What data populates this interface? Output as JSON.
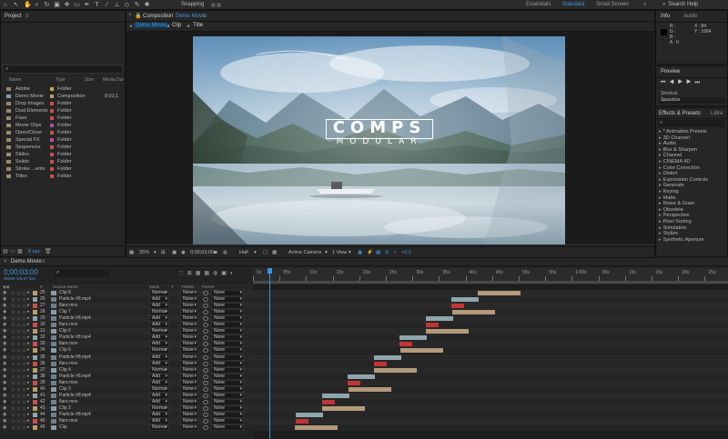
{
  "toolbar": {
    "snapping": "Snapping",
    "workspaces": [
      "Essentials",
      "Standard",
      "Small Screen"
    ],
    "active_workspace": "Standard",
    "search": "Search Help"
  },
  "project": {
    "tab": "Project",
    "columns": [
      "Name",
      "Type",
      "Size",
      "Media Dur"
    ],
    "items": [
      {
        "name": "Adobe",
        "type": "Folder",
        "size": "",
        "color": "#d4a24a"
      },
      {
        "name": "Demo Movie",
        "type": "Composition",
        "size": "0;01;1",
        "color": "#b9a06a"
      },
      {
        "name": "Drop Images",
        "type": "Folder",
        "size": "",
        "color": "#c85050"
      },
      {
        "name": "Dust Elements",
        "type": "Folder",
        "size": "",
        "color": "#c85050"
      },
      {
        "name": "Flare",
        "type": "Folder",
        "size": "",
        "color": "#c85050"
      },
      {
        "name": "Movie Clips",
        "type": "Folder",
        "size": "",
        "color": "#b04fa8"
      },
      {
        "name": "Open/Close",
        "type": "Folder",
        "size": "",
        "color": "#c85050"
      },
      {
        "name": "Special FX",
        "type": "Folder",
        "size": "",
        "color": "#b04fa8"
      },
      {
        "name": "Sequences",
        "type": "Folder",
        "size": "",
        "color": "#c85050"
      },
      {
        "name": "Slides",
        "type": "Folder",
        "size": "",
        "color": "#c85050"
      },
      {
        "name": "Solids",
        "type": "Folder",
        "size": "",
        "color": "#c85050"
      },
      {
        "name": "Stroke ...ents",
        "type": "Folder",
        "size": "",
        "color": "#c85050"
      },
      {
        "name": "Titles",
        "type": "Folder",
        "size": "",
        "color": "#c85050"
      }
    ],
    "bpc": "8 bpc"
  },
  "composition": {
    "tab_prefix": "Composition",
    "tab_name": "Demo Movie",
    "breadcrumbs": [
      "Demo Movie",
      "Clip",
      "Title"
    ],
    "title_main": "COMPS",
    "title_sub": "MODULAR",
    "zoom": "25%",
    "timecode": "0;00;03;00",
    "resolution": "Half",
    "camera": "Active Camera",
    "view": "1 View",
    "exposure": "+0.0"
  },
  "info": {
    "tabs": [
      "Info",
      "Audio"
    ],
    "channels": [
      "R :",
      "G :",
      "B :",
      "A : 0"
    ],
    "x": "X : 84",
    "y": "Y : 1664"
  },
  "preview": {
    "tab": "Preview",
    "shortcut_label": "Shortcut",
    "shortcut_value": "Spacebar"
  },
  "effects": {
    "tabs": [
      "Effects & Presets",
      "Libra"
    ],
    "items": [
      "* Animation Presets",
      "3D Channel",
      "Audio",
      "Blur & Sharpen",
      "Channel",
      "CINEMA 4D",
      "Color Correction",
      "Distort",
      "Expression Controls",
      "Generate",
      "Keying",
      "Matte",
      "Noise & Grain",
      "Obsolete",
      "Perspective",
      "Pixel Sorting",
      "Simulation",
      "Stylize",
      "Synthetic Aperture"
    ]
  },
  "timeline": {
    "tab": "Demo Movie",
    "timecode": "0;00;03;00",
    "fps": "00090 (29.97 fps)",
    "columns": [
      "#",
      "Source Name",
      "Mode",
      "T",
      "TrkMat",
      "Parent"
    ],
    "ruler": [
      "0s",
      "05s",
      "10s",
      "15s",
      "20s",
      "25s",
      "30s",
      "35s",
      "40s",
      "45s",
      "50s",
      "55s",
      "1:00s",
      "05s",
      "10s",
      "15s",
      "20s",
      "25s"
    ],
    "layers": [
      {
        "num": "25",
        "name": "Clip 8",
        "mode": "Norma",
        "trk": "None",
        "parent": "None",
        "type": "clip"
      },
      {
        "num": "26",
        "name": "Particle #8.mp4",
        "mode": "Add",
        "trk": "None",
        "parent": "None",
        "type": "part"
      },
      {
        "num": "27",
        "name": "flare.mov",
        "mode": "Add",
        "trk": "None",
        "parent": "None",
        "type": "flare"
      },
      {
        "num": "28",
        "name": "Clip 7",
        "mode": "Norma",
        "trk": "None",
        "parent": "None",
        "type": "clip"
      },
      {
        "num": "29",
        "name": "Particle #8.mp4",
        "mode": "Add",
        "trk": "None",
        "parent": "None",
        "type": "part"
      },
      {
        "num": "30",
        "name": "flare.mov",
        "mode": "Add",
        "trk": "None",
        "parent": "None",
        "type": "flare"
      },
      {
        "num": "31",
        "name": "Clip 6",
        "mode": "Norma",
        "trk": "None",
        "parent": "None",
        "type": "clip"
      },
      {
        "num": "32",
        "name": "Particle #8.mp4",
        "mode": "Add",
        "trk": "None",
        "parent": "None",
        "type": "part"
      },
      {
        "num": "33",
        "name": "flare.mov",
        "mode": "Add",
        "trk": "None",
        "parent": "None",
        "type": "flare"
      },
      {
        "num": "34",
        "name": "Clip 5",
        "mode": "Norma",
        "trk": "None",
        "parent": "None",
        "type": "clip"
      },
      {
        "num": "35",
        "name": "Particle #8.mp4",
        "mode": "Add",
        "trk": "None",
        "parent": "None",
        "type": "part"
      },
      {
        "num": "36",
        "name": "flare.mov",
        "mode": "Add",
        "trk": "None",
        "parent": "None",
        "type": "flare"
      },
      {
        "num": "37",
        "name": "Clip 4",
        "mode": "Norma",
        "trk": "None",
        "parent": "None",
        "type": "clip"
      },
      {
        "num": "38",
        "name": "Particle #8.mp4",
        "mode": "Add",
        "trk": "None",
        "parent": "None",
        "type": "part"
      },
      {
        "num": "39",
        "name": "flare.mov",
        "mode": "Add",
        "trk": "None",
        "parent": "None",
        "type": "flare"
      },
      {
        "num": "40",
        "name": "Clip 3",
        "mode": "Norma",
        "trk": "None",
        "parent": "None",
        "type": "clip"
      },
      {
        "num": "41",
        "name": "Particle #8.mp4",
        "mode": "Add",
        "trk": "None",
        "parent": "None",
        "type": "part"
      },
      {
        "num": "42",
        "name": "flare.mov",
        "mode": "Add",
        "trk": "None",
        "parent": "None",
        "type": "flare"
      },
      {
        "num": "43",
        "name": "Clip 2",
        "mode": "Norma",
        "trk": "None",
        "parent": "None",
        "type": "clip"
      },
      {
        "num": "44",
        "name": "Particle #8.mp4",
        "mode": "Add",
        "trk": "None",
        "parent": "None",
        "type": "part"
      },
      {
        "num": "45",
        "name": "flare.mov",
        "mode": "Add",
        "trk": "None",
        "parent": "None",
        "type": "flare"
      },
      {
        "num": "46",
        "name": "Clip",
        "mode": "Norma",
        "trk": "None",
        "parent": "None",
        "type": "clip"
      }
    ]
  },
  "colors": {
    "accent": "#3d94e0",
    "clip_bar": "#b39a7a",
    "particle_bar": "#8fa6ad",
    "flare_bar": "#c23434",
    "label_clip": "#b9a06a",
    "label_part": "#8fa6ad",
    "label_flare": "#c85050"
  }
}
